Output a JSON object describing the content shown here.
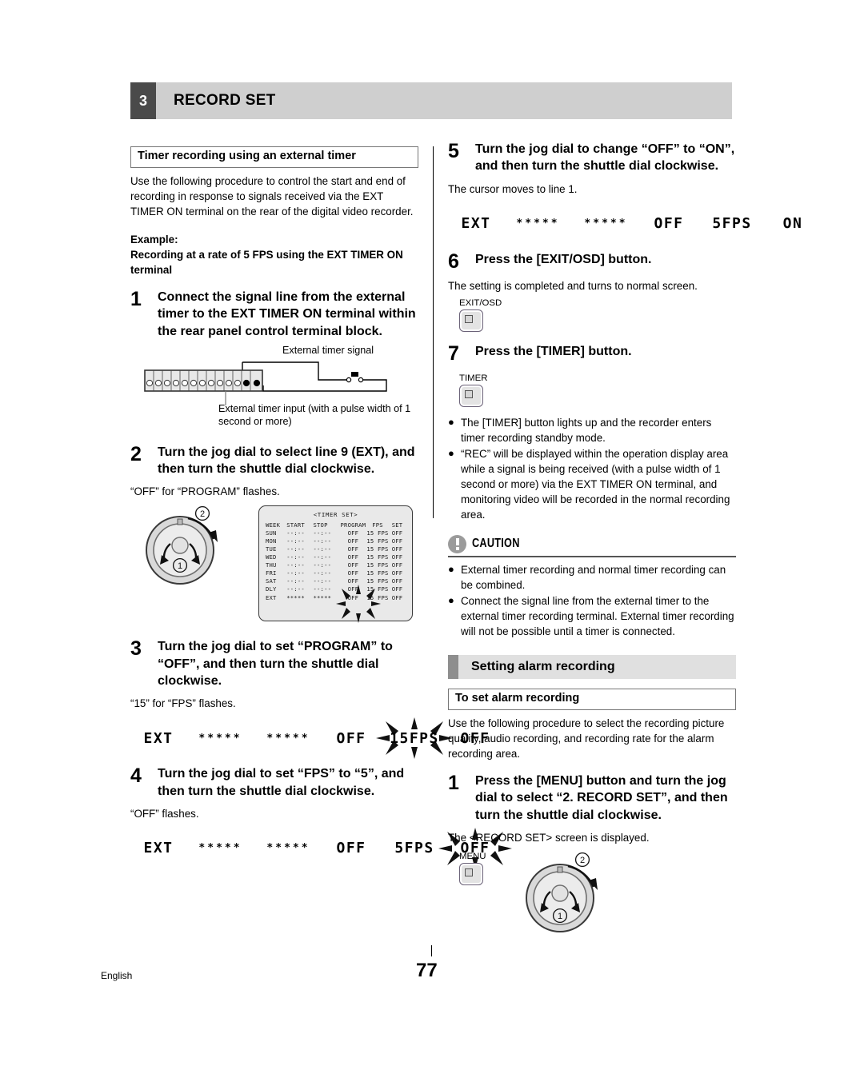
{
  "header": {
    "chapter_number": "3",
    "chapter_title": "RECORD SET"
  },
  "left": {
    "box_heading": "Timer recording using an external timer",
    "intro": "Use the following procedure to control the start and end of recording in response to signals received via the EXT TIMER ON terminal on the rear of the digital video recorder.",
    "example_label": "Example:",
    "example_text": "Recording at a rate of 5 FPS using the EXT TIMER ON terminal",
    "step1": {
      "num": "1",
      "text": "Connect the signal line from the external timer to the EXT TIMER ON terminal within the rear panel control terminal block.",
      "fig_label_top": "External timer signal",
      "fig_label_bottom": "External timer input (with a pulse width of 1 second or more)"
    },
    "step2": {
      "num": "2",
      "text": "Turn the jog dial to select line 9 (EXT), and then turn the shuttle dial clockwise.",
      "note": "“OFF” for “PROGRAM” flashes.",
      "jog_marker_1": "1",
      "jog_marker_2": "2"
    },
    "step3": {
      "num": "3",
      "text": "Turn the jog dial to set “PROGRAM” to “OFF”, and then turn the shuttle dial clockwise.",
      "note": "“15” for “FPS” flashes.",
      "lcd": {
        "week": "EXT",
        "start": "*****",
        "stop": "*****",
        "program": "OFF",
        "fps": "15FPS",
        "set": "OFF",
        "flashing": "fps"
      }
    },
    "step4": {
      "num": "4",
      "text": "Turn the jog dial to set “FPS” to “5”, and then turn the shuttle dial clockwise.",
      "note": "“OFF” flashes.",
      "lcd": {
        "week": "EXT",
        "start": "*****",
        "stop": "*****",
        "program": "OFF",
        "fps": "5FPS",
        "set": "OFF",
        "flashing": "set"
      }
    }
  },
  "osd": {
    "title": "<TIMER SET>",
    "headers": [
      "WEEK",
      "START",
      "STOP",
      "PROGRAM",
      "FPS",
      "SET"
    ],
    "rows": [
      [
        "SUN",
        "--:--",
        "--:--",
        "OFF",
        "15 FPS",
        "OFF"
      ],
      [
        "MON",
        "--:--",
        "--:--",
        "OFF",
        "15 FPS",
        "OFF"
      ],
      [
        "TUE",
        "--:--",
        "--:--",
        "OFF",
        "15 FPS",
        "OFF"
      ],
      [
        "WED",
        "--:--",
        "--:--",
        "OFF",
        "15 FPS",
        "OFF"
      ],
      [
        "THU",
        "--:--",
        "--:--",
        "OFF",
        "15 FPS",
        "OFF"
      ],
      [
        "FRI",
        "--:--",
        "--:--",
        "OFF",
        "15 FPS",
        "OFF"
      ],
      [
        "SAT",
        "--:--",
        "--:--",
        "OFF",
        "15 FPS",
        "OFF"
      ],
      [
        "DLY",
        "--:--",
        "--:--",
        "OFF",
        "15 FPS",
        "OFF"
      ],
      [
        "EXT",
        "*****",
        "*****",
        "OFF",
        "15 FPS",
        "OFF"
      ]
    ]
  },
  "right": {
    "step5": {
      "num": "5",
      "text": "Turn the jog dial to change “OFF” to “ON”, and then turn the shuttle dial clockwise.",
      "note": "The cursor moves to line 1.",
      "lcd": {
        "week": "EXT",
        "start": "*****",
        "stop": "*****",
        "program": "OFF",
        "fps": "5FPS",
        "set": "ON",
        "flashing": "none"
      }
    },
    "step6": {
      "num": "6",
      "text": "Press the [EXIT/OSD] button.",
      "note": "The setting is completed and turns to normal screen.",
      "button_label": "EXIT/OSD"
    },
    "step7": {
      "num": "7",
      "text": "Press the [TIMER] button.",
      "button_label": "TIMER",
      "bullets": [
        "The [TIMER] button lights up and the recorder enters timer recording standby mode.",
        "“REC” will be displayed within the operation display area while a signal is being received (with a pulse width of 1 second or more) via the EXT TIMER ON terminal, and monitoring video will be recorded in the normal recording area."
      ]
    },
    "caution": {
      "title": "CAUTION",
      "bullets": [
        "External timer recording and normal timer recording can be combined.",
        "Connect the signal line from the external timer to the external timer recording terminal. External timer recording will not be possible until a timer is connected."
      ]
    },
    "section": {
      "title": "Setting alarm recording",
      "box_heading": "To set alarm recording",
      "intro": "Use the following procedure to select the recording picture quality, audio recording, and recording rate for the alarm recording area.",
      "step1": {
        "num": "1",
        "text": "Press the [MENU] button and turn the jog dial to select “2. RECORD SET”, and then turn the shuttle dial clockwise.",
        "note": "The <RECORD SET> screen is displayed.",
        "button_label": "MENU",
        "jog_marker_1": "1",
        "jog_marker_2": "2"
      }
    }
  },
  "footer": {
    "language": "English",
    "page_number": "77"
  }
}
